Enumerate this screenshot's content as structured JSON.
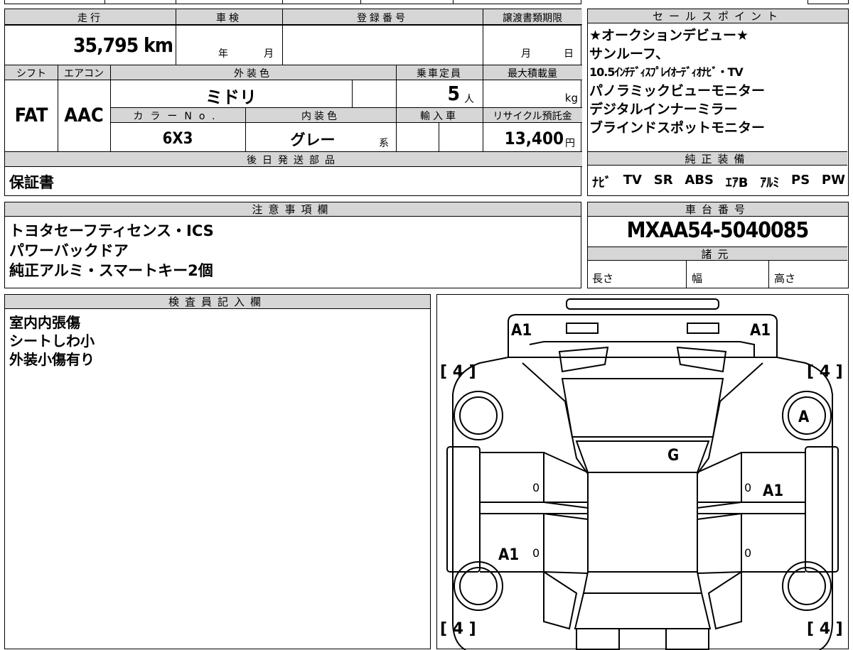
{
  "vehicle": {
    "headers": {
      "mileage": "走行",
      "inspection": "車検",
      "registration": "登録番号",
      "transfer_deadline": "譲渡書類期限",
      "shift": "シフト",
      "aircon": "エアコン",
      "exterior_color": "外装色",
      "capacity": "乗車定員",
      "max_load": "最大積載量",
      "color_no": "カラーNo.",
      "interior_color": "内装色",
      "import": "輸入車",
      "recycle_fee": "リサイクル預託金"
    },
    "mileage_value": "35,795 km",
    "inspection_year_unit": "年",
    "inspection_month_unit": "月",
    "deadline_month_unit": "月",
    "deadline_day_unit": "日",
    "shift_value": "FAT",
    "aircon_value": "AAC",
    "exterior_color_value": "ミドリ",
    "capacity_value": "5",
    "capacity_unit": "人",
    "max_load_unit": "kg",
    "color_no_value": "6X3",
    "interior_color_value": "グレー",
    "interior_color_suffix": "系",
    "recycle_fee_value": "13,400",
    "recycle_fee_unit": "円"
  },
  "later_shipping": {
    "header": "後日発送部品",
    "value": "保証書"
  },
  "sales_points": {
    "header": "セールスポイント",
    "lines": [
      "★オークションデビュー★",
      "サンルーフ、",
      "10.5ｲﾝﾁﾃﾞｨｽﾌﾟﾚｲｵｰﾃﾞｨｵﾅﾋﾞ・TV",
      "パノラミックビューモニター",
      "デジタルインナーミラー",
      "ブラインドスポットモニター"
    ]
  },
  "genuine_equipment": {
    "header": "純正装備",
    "items": [
      "ﾅﾋﾞ",
      "TV",
      "SR",
      "ABS",
      "ｴｱB",
      "ｱﾙﾐ",
      "PS",
      "PW"
    ]
  },
  "notes": {
    "header": "注意事項欄",
    "lines": [
      "トヨタセーフティセンス・ICS",
      "パワーバックドア",
      "純正アルミ・スマートキー2個"
    ]
  },
  "chassis": {
    "header": "車台番号",
    "value": "MXAA54-5040085"
  },
  "specs": {
    "header": "諸元",
    "length_label": "長さ",
    "width_label": "幅",
    "height_label": "高さ"
  },
  "inspector": {
    "header": "検査員記入欄",
    "lines": [
      "室内内張傷",
      "シートしわ小",
      "外装小傷有り"
    ]
  },
  "damage_map": {
    "tire_left_top": "[ 4 ]",
    "tire_right_top": "[ 4 ]",
    "tire_left_bottom": "[ 4 ]",
    "tire_right_bottom": "[ 4 ]",
    "front_left": "A1",
    "front_right": "A1",
    "right_front_fender": "A",
    "windshield": "G",
    "right_rear_door": "A1",
    "left_rear_door": "A1",
    "panel_zero": "0"
  }
}
